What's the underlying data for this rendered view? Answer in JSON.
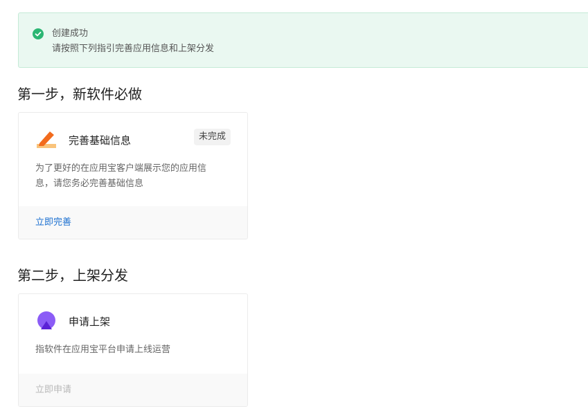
{
  "alert": {
    "icon": "check-circle-icon",
    "title": "创建成功",
    "description": "请按照下列指引完善应用信息和上架分发",
    "color": "#2bb673"
  },
  "step1": {
    "title": "第一步，新软件必做",
    "card": {
      "icon": "pencil-icon",
      "name": "完善基础信息",
      "status": "未完成",
      "description_line1": "为了更好的在应用宝客户端展示您的应用信",
      "description_line2": "息，请您务必完善基础信息",
      "action": "立即完善"
    }
  },
  "step2": {
    "title": "第二步，上架分发",
    "card": {
      "icon": "publish-icon",
      "name": "申请上架",
      "description": "指软件在应用宝平台申请上线运营",
      "action": "立即申请"
    }
  },
  "colors": {
    "link": "#1a6fd0",
    "success": "#2bb673",
    "pencil": "#f26b1d",
    "publish": "#8b5cf6"
  }
}
